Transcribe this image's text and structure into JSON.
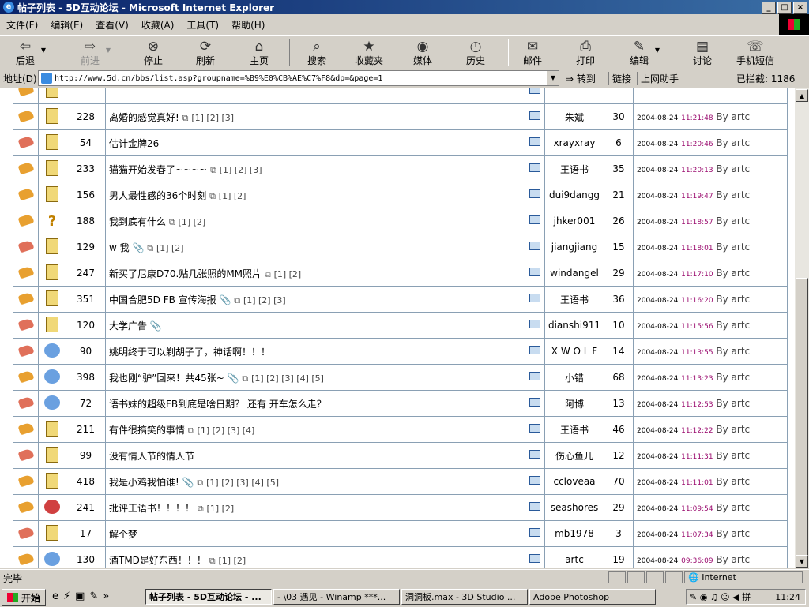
{
  "window": {
    "title": "帖子列表 - 5D互动论坛 - Microsoft Internet Explorer"
  },
  "menu": [
    "文件(F)",
    "编辑(E)",
    "查看(V)",
    "收藏(A)",
    "工具(T)",
    "帮助(H)"
  ],
  "toolbar": {
    "back": "后退",
    "forward": "前进",
    "stop": "停止",
    "refresh": "刷新",
    "home": "主页",
    "search": "搜索",
    "favorites": "收藏夹",
    "media": "媒体",
    "history": "历史",
    "mail": "邮件",
    "print": "打印",
    "edit": "编辑",
    "discuss": "讨论",
    "sms": "手机短信"
  },
  "address": {
    "label": "地址(D)",
    "url": "http://www.5d.cn/bbs/list.asp?groupname=%B9%E0%CB%AE%C7%F8&dp=&page=1",
    "go": "转到",
    "links": "链接",
    "helper": "上网助手",
    "blocked": "已拦截: 1186"
  },
  "rows": [
    {
      "icon": "hot",
      "type": "doc",
      "replies": "228",
      "title": "离婚的感觉真好!",
      "attach": false,
      "pages": "[1] [2] [3]",
      "author": "朱斌",
      "views": "30",
      "date": "2004-08-24",
      "time": "11:21:48",
      "by": "By artc"
    },
    {
      "icon": "normal",
      "type": "doc",
      "replies": "54",
      "title": "估计金牌26",
      "attach": false,
      "pages": "",
      "author": "xrayxray",
      "views": "6",
      "date": "2004-08-24",
      "time": "11:20:46",
      "by": "By artc"
    },
    {
      "icon": "hot",
      "type": "doc",
      "replies": "233",
      "title": "猫猫开始发春了~~~~",
      "attach": false,
      "pages": "[1] [2] [3]",
      "author": "王语书",
      "views": "35",
      "date": "2004-08-24",
      "time": "11:20:13",
      "by": "By artc"
    },
    {
      "icon": "hot",
      "type": "doc",
      "replies": "156",
      "title": "男人最性感的36个时刻",
      "attach": false,
      "pages": "[1] [2]",
      "author": "dui9dangg",
      "views": "21",
      "date": "2004-08-24",
      "time": "11:19:47",
      "by": "By artc"
    },
    {
      "icon": "hot",
      "type": "question",
      "replies": "188",
      "title": "我到底有什么",
      "attach": false,
      "pages": "[1] [2]",
      "author": "jhker001",
      "views": "26",
      "date": "2004-08-24",
      "time": "11:18:57",
      "by": "By artc"
    },
    {
      "icon": "normal",
      "type": "doc",
      "replies": "129",
      "title": "w 我",
      "attach": true,
      "pages": "[1] [2]",
      "author": "jiangjiang",
      "views": "15",
      "date": "2004-08-24",
      "time": "11:18:01",
      "by": "By artc"
    },
    {
      "icon": "hot",
      "type": "doc",
      "replies": "247",
      "title": "新买了尼康D70.贴几张照的MM照片",
      "attach": false,
      "pages": "[1] [2]",
      "author": "windangel",
      "views": "29",
      "date": "2004-08-24",
      "time": "11:17:10",
      "by": "By artc"
    },
    {
      "icon": "hot",
      "type": "doc",
      "replies": "351",
      "title": "中国合肥5D FB 宣传海报",
      "attach": true,
      "pages": "[1] [2] [3]",
      "author": "王语书",
      "views": "36",
      "date": "2004-08-24",
      "time": "11:16:20",
      "by": "By artc"
    },
    {
      "icon": "normal",
      "type": "doc",
      "replies": "120",
      "title": "大学广告",
      "attach": true,
      "pages": "",
      "author": "dianshi911",
      "views": "10",
      "date": "2004-08-24",
      "time": "11:15:56",
      "by": "By artc"
    },
    {
      "icon": "normal",
      "type": "bot",
      "replies": "90",
      "title": "姚明终于可以剃胡子了，神话啊！！！",
      "attach": false,
      "pages": "",
      "author": "X W O L F",
      "views": "14",
      "date": "2004-08-24",
      "time": "11:13:55",
      "by": "By artc"
    },
    {
      "icon": "hot",
      "type": "bot",
      "replies": "398",
      "title": "我也刚“驴”回来！共45张~",
      "attach": true,
      "pages": "[1] [2] [3] [4] [5]",
      "author": "小错",
      "views": "68",
      "date": "2004-08-24",
      "time": "11:13:23",
      "by": "By artc"
    },
    {
      "icon": "normal",
      "type": "bot",
      "replies": "72",
      "title": "语书妹的超级FB到底是啥日期？ 还有 开车怎么走？",
      "attach": false,
      "pages": "",
      "author": "阿博",
      "views": "13",
      "date": "2004-08-24",
      "time": "11:12:53",
      "by": "By artc"
    },
    {
      "icon": "hot",
      "type": "doc",
      "replies": "211",
      "title": "有件很搞笑的事情",
      "attach": false,
      "pages": "[1] [2] [3] [4]",
      "author": "王语书",
      "views": "46",
      "date": "2004-08-24",
      "time": "11:12:22",
      "by": "By artc"
    },
    {
      "icon": "normal",
      "type": "doc",
      "replies": "99",
      "title": "没有情人节的情人节",
      "attach": false,
      "pages": "",
      "author": "伤心鱼儿",
      "views": "12",
      "date": "2004-08-24",
      "time": "11:11:31",
      "by": "By artc"
    },
    {
      "icon": "hot",
      "type": "doc",
      "replies": "418",
      "title": "我是小鸡我怕谁!",
      "attach": true,
      "pages": "[1] [2] [3] [4] [5]",
      "author": "ccloveaa",
      "views": "70",
      "date": "2004-08-24",
      "time": "11:11:01",
      "by": "By artc"
    },
    {
      "icon": "hot",
      "type": "botred",
      "replies": "241",
      "title": "批评王语书！！！！",
      "attach": false,
      "pages": "[1] [2]",
      "author": "seashores",
      "views": "29",
      "date": "2004-08-24",
      "time": "11:09:54",
      "by": "By artc"
    },
    {
      "icon": "normal",
      "type": "doc",
      "replies": "17",
      "title": "解个梦",
      "attach": false,
      "pages": "",
      "author": "mb1978",
      "views": "3",
      "date": "2004-08-24",
      "time": "11:07:34",
      "by": "By artc"
    },
    {
      "icon": "hot",
      "type": "bot",
      "replies": "130",
      "title": "酒TMD是好东西！！！",
      "attach": false,
      "pages": "[1] [2]",
      "author": "artc",
      "views": "19",
      "date": "2004-08-24",
      "time": "09:36:09",
      "by": "By artc"
    }
  ],
  "status": {
    "text": "完毕",
    "zone": "Internet"
  },
  "taskbar": {
    "start": "开始",
    "tasks": [
      "帖子列表 - 5D互动论坛 - ...",
      "- \\03 遇见 - Winamp ***...",
      "洞洞板.max - 3D Studio ...",
      "Adobe Photoshop"
    ],
    "clock": "11:24"
  }
}
